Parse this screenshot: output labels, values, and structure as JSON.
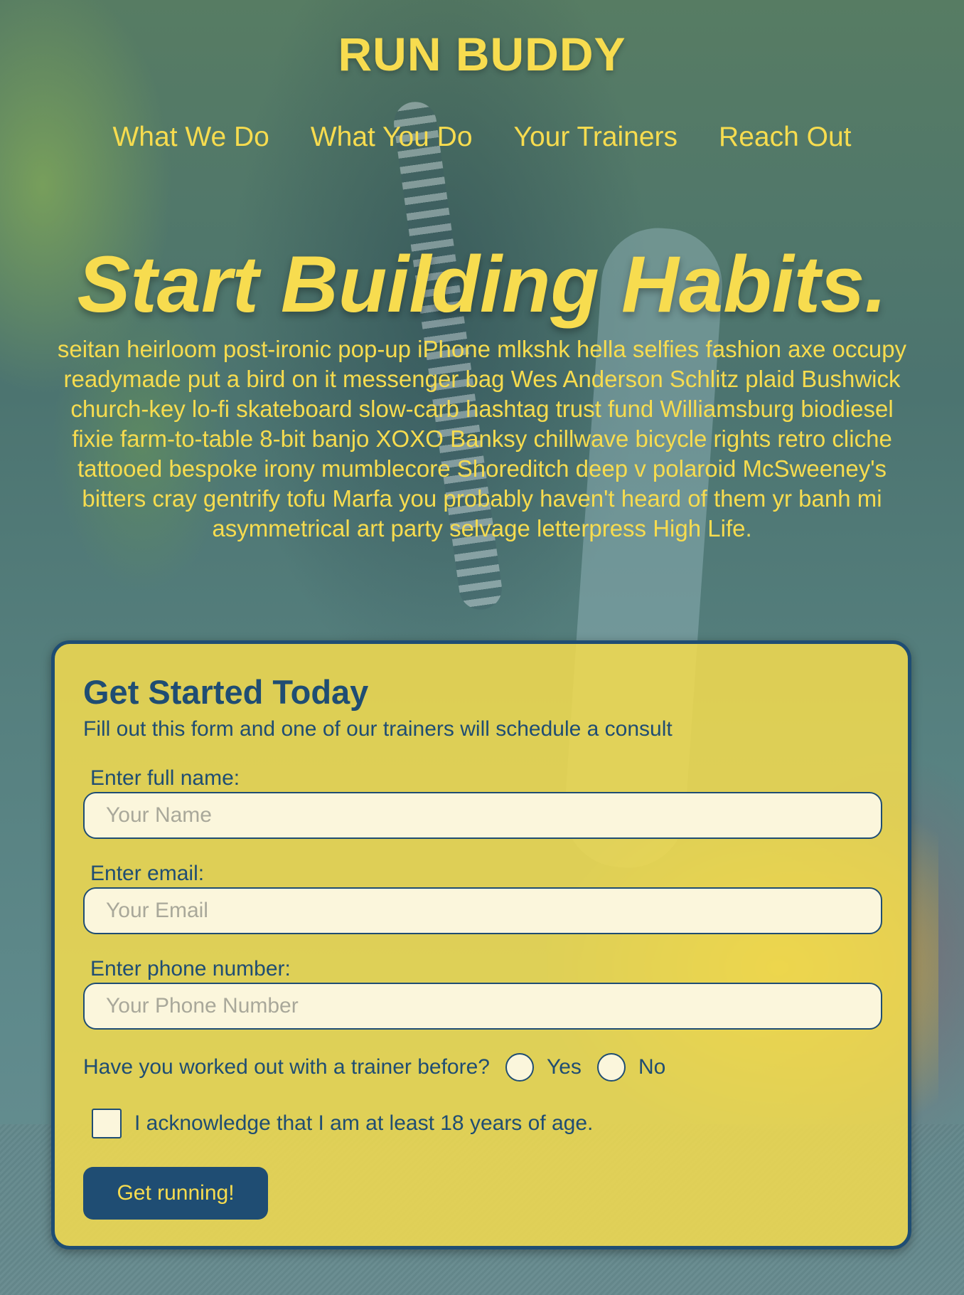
{
  "site": {
    "title": "RUN BUDDY"
  },
  "nav": {
    "items": [
      {
        "label": "What We Do"
      },
      {
        "label": "What You Do"
      },
      {
        "label": "Your Trainers"
      },
      {
        "label": "Reach Out"
      }
    ]
  },
  "hero": {
    "heading": "Start Building Habits.",
    "text": "seitan heirloom post-ironic pop-up iPhone mlkshk hella selfies fashion axe occupy readymade put a bird on it messenger bag Wes Anderson Schlitz plaid Bushwick church-key lo-fi skateboard slow-carb hashtag trust fund Williamsburg biodiesel fixie farm-to-table 8-bit banjo XOXO Banksy chillwave bicycle rights retro cliche tattooed bespoke irony mumblecore Shoreditch deep v polaroid McSweeney's bitters cray gentrify tofu Marfa you probably haven't heard of them yr banh mi asymmetrical art party selvage letterpress High Life."
  },
  "form": {
    "title": "Get Started Today",
    "subtitle": "Fill out this form and one of our trainers will schedule a consult",
    "fields": [
      {
        "label": "Enter full name:",
        "placeholder": "Your Name",
        "value": ""
      },
      {
        "label": "Enter email:",
        "placeholder": "Your Email",
        "value": ""
      },
      {
        "label": "Enter phone number:",
        "placeholder": "Your Phone Number",
        "value": ""
      }
    ],
    "radio": {
      "question": "Have you worked out with a trainer before?",
      "options": [
        {
          "label": "Yes",
          "checked": false
        },
        {
          "label": "No",
          "checked": false
        }
      ]
    },
    "checkbox": {
      "label": "I acknowledge that I am at least 18 years of age.",
      "checked": false
    },
    "submit_label": "Get running!"
  },
  "colors": {
    "accent_yellow": "#f7dc4f",
    "brand_navy": "#1f4d73",
    "form_background": "#f0da50",
    "input_background": "#fbf6dc"
  }
}
